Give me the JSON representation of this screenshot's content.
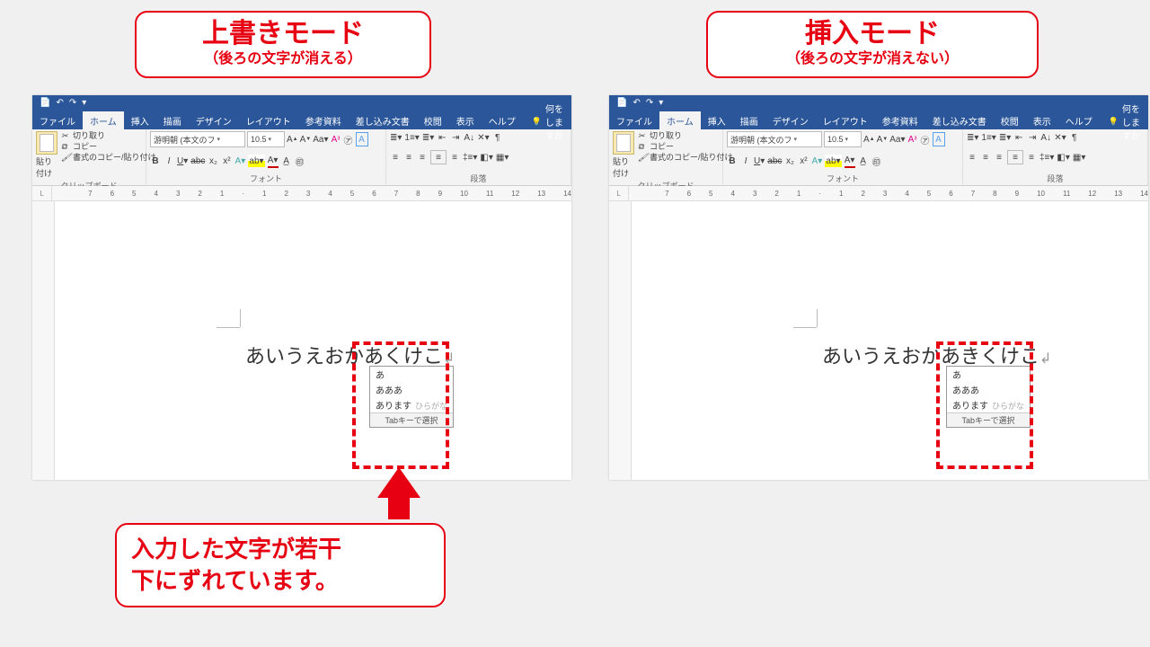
{
  "callouts": {
    "left": {
      "title": "上書きモード",
      "sub": "（後ろの文字が消える）"
    },
    "right": {
      "title": "挿入モード",
      "sub": "（後ろの文字が消えない）"
    },
    "bottom": {
      "line1": "入力した文字が若干",
      "line2": "下にずれています。"
    }
  },
  "ribbon": {
    "tabs": {
      "file": "ファイル",
      "home": "ホーム",
      "insert": "挿入",
      "draw": "描画",
      "design": "デザイン",
      "layout": "レイアウト",
      "references": "参考資料",
      "mailings": "差し込み文書",
      "review": "校閲",
      "view": "表示",
      "help": "ヘルプ",
      "tell": "何をしますか"
    },
    "groups": {
      "clipboard": "クリップボード",
      "font": "フォント",
      "paragraph": "段落"
    },
    "clipboard": {
      "paste": "貼り付け",
      "cut": "切り取り",
      "copy": "コピー",
      "formatPainter": "書式のコピー/貼り付け"
    },
    "font": {
      "name": "游明朝 (本文のフ",
      "size": "10.5"
    }
  },
  "ruler": {
    "corner": "L",
    "marks": [
      "7",
      "6",
      "5",
      "4",
      "3",
      "2",
      "1",
      "",
      "1",
      "2",
      "3",
      "4",
      "5",
      "6",
      "7",
      "8",
      "9",
      "10",
      "11",
      "12",
      "13",
      "14"
    ]
  },
  "document": {
    "left": {
      "text": "あいうえおかあくけこ"
    },
    "right": {
      "text": "あいうえおかあきくけこ"
    }
  },
  "ime": {
    "opt1": "あ",
    "opt2": "あああ",
    "opt3": "あります",
    "hint": "ひらがな",
    "footer": "Tabキーで選択"
  }
}
